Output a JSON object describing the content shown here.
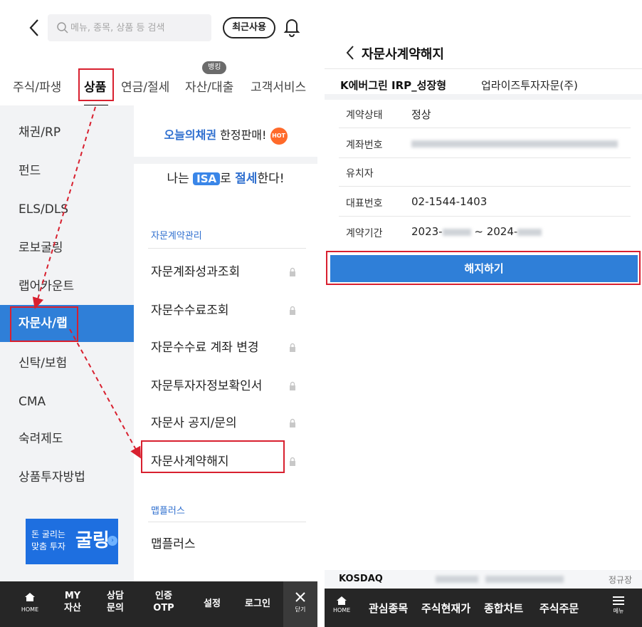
{
  "left": {
    "search_placeholder": "메뉴, 종목, 상품 등 검색",
    "recent_label": "최근사용",
    "category_tabs": [
      "주식/파생",
      "상품",
      "연금/절세",
      "자산/대출",
      "고객서비스"
    ],
    "banking_badge": "뱅킹",
    "menu_items": [
      "채권/RP",
      "펀드",
      "ELS/DLS",
      "로보굴링",
      "랩어카운트",
      "자문사/랩",
      "신탁/보험",
      "CMA",
      "숙려제도",
      "상품투자방법"
    ],
    "banner1": {
      "highlight": "오늘의채권",
      "rest": " 한정판매!",
      "hot": "HOT"
    },
    "banner2": {
      "pre": "나는 ",
      "isa": "ISA",
      "mid": "로 ",
      "blue": "절세",
      "post": "한다!"
    },
    "section1": "자문계약관리",
    "sub_items": [
      "자문계좌성과조회",
      "자문수수료조회",
      "자문수수료 계좌 변경",
      "자문투자자정보확인서",
      "자문사 공지/문의",
      "자문사계약해지"
    ],
    "section2": "맵플러스",
    "sub_item_map": "맵플러스",
    "promo": {
      "line1": "돈 굴리는",
      "line2": "맞춤 투자",
      "big": "굴링"
    },
    "bottom_nav": {
      "home": "HOME",
      "my_asset": [
        "MY",
        "자산"
      ],
      "consult": [
        "상담",
        "문의"
      ],
      "otp": [
        "인증",
        "OTP"
      ],
      "settings": "설정",
      "login": "로그인",
      "close": "닫기"
    }
  },
  "right": {
    "title": "자문사계약해지",
    "product_name": "K에버그린 IRP_성장형",
    "company": "업라이즈투자자문(주)",
    "rows": [
      {
        "key": "계약상태",
        "value": "정상"
      },
      {
        "key": "계좌번호",
        "value": ""
      },
      {
        "key": "유치자",
        "value": ""
      },
      {
        "key": "대표번호",
        "value": "02-1544-1403"
      },
      {
        "key": "계약기간",
        "value_start": "2023-",
        "value_mid": "~ 2024-"
      }
    ],
    "cancel_label": "해지하기",
    "ticker_name": "KOSDAQ",
    "ticker_right": "정규장",
    "bottom_nav": {
      "home": "HOME",
      "items": [
        "관심종목",
        "주식현재가",
        "종합차트",
        "주식주문"
      ],
      "menu": "메뉴"
    }
  },
  "colors": {
    "accent": "#2f7fd8",
    "highlight_box": "#d8202f",
    "nav_bg": "#262626"
  }
}
